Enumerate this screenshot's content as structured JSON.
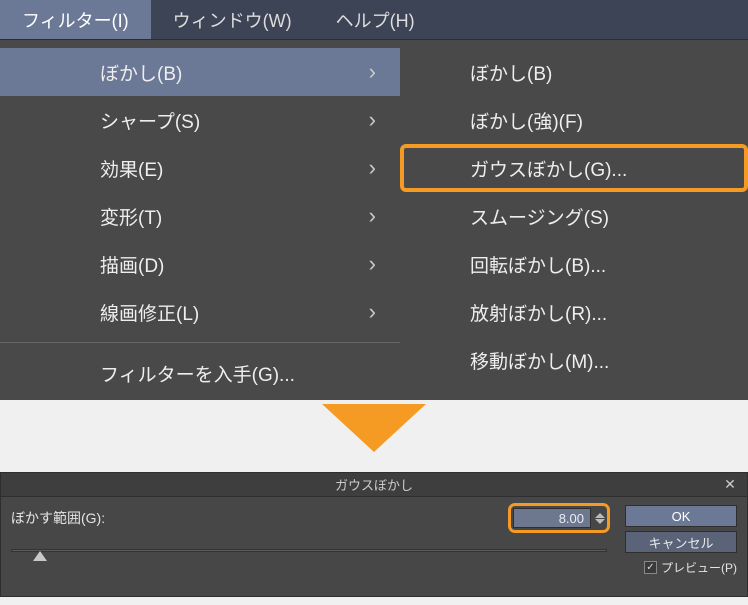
{
  "menubar": {
    "items": [
      {
        "label": "フィルター(I)",
        "active": true
      },
      {
        "label": "ウィンドウ(W)",
        "active": false
      },
      {
        "label": "ヘルプ(H)",
        "active": false
      }
    ]
  },
  "menu": {
    "items": [
      {
        "label": "ぼかし(B)",
        "has_sub": true,
        "highlighted": true
      },
      {
        "label": "シャープ(S)",
        "has_sub": true
      },
      {
        "label": "効果(E)",
        "has_sub": true
      },
      {
        "label": "変形(T)",
        "has_sub": true
      },
      {
        "label": "描画(D)",
        "has_sub": true
      },
      {
        "label": "線画修正(L)",
        "has_sub": true
      }
    ],
    "divider_after": 5,
    "extra": {
      "label": "フィルターを入手(G)..."
    }
  },
  "submenu": {
    "items": [
      {
        "label": "ぼかし(B)"
      },
      {
        "label": "ぼかし(強)(F)"
      },
      {
        "label": "ガウスぼかし(G)...",
        "boxed": true
      },
      {
        "label": "スムージング(S)"
      },
      {
        "label": "回転ぼかし(B)..."
      },
      {
        "label": "放射ぼかし(R)..."
      },
      {
        "label": "移動ぼかし(M)..."
      }
    ]
  },
  "dialog": {
    "title": "ガウスぼかし",
    "param_label": "ぼかす範囲(G):",
    "param_value": "8.00",
    "ok_label": "OK",
    "cancel_label": "キャンセル",
    "preview_label": "プレビュー(P)",
    "preview_checked": true
  }
}
